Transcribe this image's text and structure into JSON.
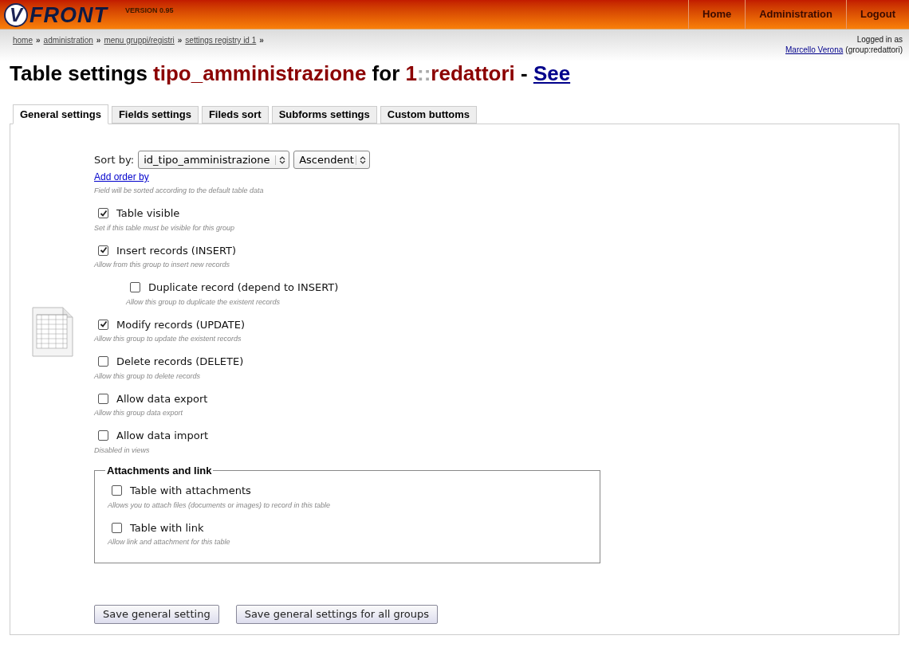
{
  "logo": {
    "letter": "V",
    "text": "FRONT",
    "version": "VERSION 0.95"
  },
  "nav": [
    {
      "label": "Home"
    },
    {
      "label": "Administration"
    },
    {
      "label": "Logout"
    }
  ],
  "breadcrumb": {
    "separator": "»",
    "items": [
      "home",
      "administration",
      "menu gruppi/registri",
      "settings registry id 1"
    ]
  },
  "user": {
    "intro": "Logged in as",
    "name": "Marcello Verona",
    "group": "(group:redattori)"
  },
  "title": [
    {
      "kind": "plain",
      "text": "Table settings "
    },
    {
      "kind": "accent",
      "text": "tipo_amministrazione"
    },
    {
      "kind": "plain",
      "text": " for "
    },
    {
      "kind": "accent",
      "text": "1"
    },
    {
      "kind": "muted",
      "text": "::"
    },
    {
      "kind": "accent",
      "text": "redattori"
    },
    {
      "kind": "plain",
      "text": " - "
    },
    {
      "kind": "link",
      "text": "See"
    }
  ],
  "tabs": [
    {
      "label": "General settings",
      "selected": true
    },
    {
      "label": "Fields settings",
      "selected": false
    },
    {
      "label": "Fileds sort",
      "selected": false
    },
    {
      "label": "Subforms settings",
      "selected": false
    },
    {
      "label": "Custom buttoms",
      "selected": false
    }
  ],
  "sort": {
    "label": "Sort by:",
    "field": "id_tipo_amministrazione",
    "direction": "Ascendent",
    "add_link": "Add order by",
    "hint": "Field will be sorted according to the default table data"
  },
  "options": [
    {
      "label": "Table visible",
      "hint": "Set if this table must be visible for this group",
      "checked": true
    },
    {
      "label": "Insert records (INSERT)",
      "hint": "Allow from this group to insert new records",
      "checked": true,
      "children": [
        {
          "label": "Duplicate record (depend to INSERT)",
          "hint": "Allow this group to duplicate the existent records",
          "checked": false
        }
      ]
    },
    {
      "label": "Modify records (UPDATE)",
      "hint": "Allow this group to update the existent records",
      "checked": true
    },
    {
      "label": "Delete records (DELETE)",
      "hint": "Allow this group to delete records",
      "checked": false
    },
    {
      "label": "Allow data export",
      "hint": "Allow this group data export",
      "checked": false
    },
    {
      "label": "Allow data import",
      "hint": "Disabled in views",
      "checked": false
    }
  ],
  "attachments": {
    "legend": "Attachments and link",
    "options": [
      {
        "label": "Table with attachments",
        "hint": "Allows you to attach files (documents or images) to record in this table",
        "checked": false
      },
      {
        "label": "Table with link",
        "hint": "Allow link and attachment for this table",
        "checked": false
      }
    ]
  },
  "buttons": [
    "Save general setting",
    "Save general settings for all groups"
  ]
}
